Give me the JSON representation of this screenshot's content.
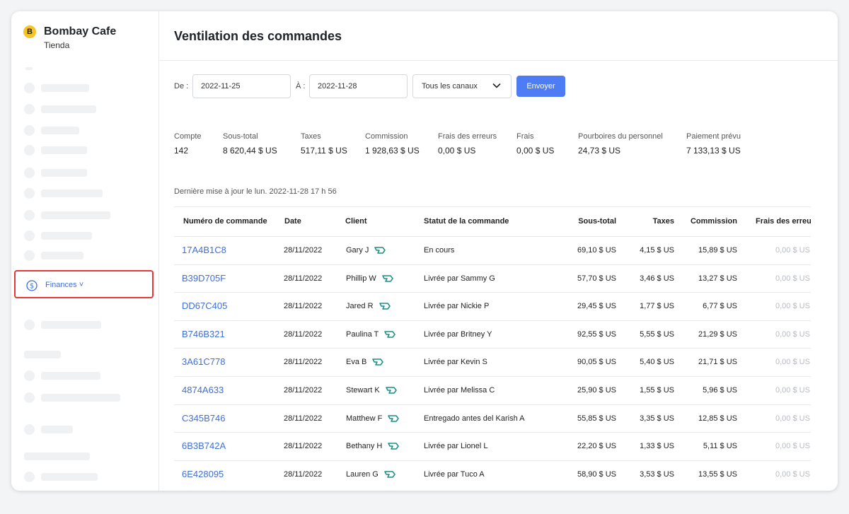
{
  "brand": {
    "badge": "B",
    "name": "Bombay Cafe",
    "subtitle": "Tienda"
  },
  "sidebar": {
    "active_item": {
      "label": "Finances ˅",
      "icon": "dollar-circle-icon"
    }
  },
  "page": {
    "title": "Ventilation des commandes"
  },
  "filters": {
    "from_label": "De :",
    "from_value": "2022-11-25",
    "to_label": "À :",
    "to_value": "2022-11-28",
    "channel_value": "Tous les canaux",
    "submit_label": "Envoyer"
  },
  "stats": [
    {
      "label": "Compte",
      "value": "142"
    },
    {
      "label": "Sous-total",
      "value": "8 620,44 $ US"
    },
    {
      "label": "Taxes",
      "value": "517,11 $ US"
    },
    {
      "label": "Commission",
      "value": "1 928,63 $ US"
    },
    {
      "label": "Frais des erreurs",
      "value": "0,00 $ US"
    },
    {
      "label": "Frais",
      "value": "0,00 $ US"
    },
    {
      "label": "Pourboires du personnel",
      "value": "24,73 $ US"
    },
    {
      "label": "Paiement prévu",
      "value": "7 133,13 $ US"
    }
  ],
  "last_updated": "Dernière mise à jour le lun. 2022-11-28 17 h 56",
  "table": {
    "headers": [
      "Numéro de commande",
      "Date",
      "Client",
      "Statut de la commande",
      "Sous-total",
      "Taxes",
      "Commission",
      "Frais des erreur"
    ],
    "rows": [
      {
        "id": "17A4B1C8",
        "date": "28/11/2022",
        "client": "Gary J",
        "status": "En cours",
        "subtotal": "69,10 $ US",
        "taxes": "4,15 $ US",
        "commission": "15,89 $ US",
        "error_fee": "0,00 $ US"
      },
      {
        "id": "B39D705F",
        "date": "28/11/2022",
        "client": "Phillip W",
        "status": "Livrée par Sammy G",
        "subtotal": "57,70 $ US",
        "taxes": "3,46 $ US",
        "commission": "13,27 $ US",
        "error_fee": "0,00 $ US"
      },
      {
        "id": "DD67C405",
        "date": "28/11/2022",
        "client": "Jared R",
        "status": "Livrée par Nickie P",
        "subtotal": "29,45 $ US",
        "taxes": "1,77 $ US",
        "commission": "6,77 $ US",
        "error_fee": "0,00 $ US"
      },
      {
        "id": "B746B321",
        "date": "28/11/2022",
        "client": "Paulina T",
        "status": "Livrée par Britney Y",
        "subtotal": "92,55 $ US",
        "taxes": "5,55 $ US",
        "commission": "21,29 $ US",
        "error_fee": "0,00 $ US"
      },
      {
        "id": "3A61C778",
        "date": "28/11/2022",
        "client": "Eva B",
        "status": "Livrée par Kevin S",
        "subtotal": "90,05 $ US",
        "taxes": "5,40 $ US",
        "commission": "21,71 $ US",
        "error_fee": "0,00 $ US"
      },
      {
        "id": "4874A633",
        "date": "28/11/2022",
        "client": "Stewart K",
        "status": "Livrée par Melissa C",
        "subtotal": "25,90 $ US",
        "taxes": "1,55 $ US",
        "commission": "5,96 $ US",
        "error_fee": "0,00 $ US"
      },
      {
        "id": "C345B746",
        "date": "28/11/2022",
        "client": "Matthew F",
        "status": "Entregado antes del Karish A",
        "subtotal": "55,85 $ US",
        "taxes": "3,35 $ US",
        "commission": "12,85 $ US",
        "error_fee": "0,00 $ US"
      },
      {
        "id": "6B3B742A",
        "date": "28/11/2022",
        "client": "Bethany H",
        "status": "Livrée par Lionel L",
        "subtotal": "22,20 $ US",
        "taxes": "1,33 $ US",
        "commission": "5,11 $ US",
        "error_fee": "0,00 $ US"
      },
      {
        "id": "6E428095",
        "date": "28/11/2022",
        "client": "Lauren G",
        "status": "Livrée par Tuco A",
        "subtotal": "58,90 $ US",
        "taxes": "3,53 $ US",
        "commission": "13,55 $ US",
        "error_fee": "0,00 $ US"
      }
    ]
  },
  "colors": {
    "accent": "#4d7cf5",
    "link": "#3f6fd8",
    "highlight_border": "#e53935",
    "brand_badge": "#f7c325",
    "client_icon": "#1a8f86"
  }
}
